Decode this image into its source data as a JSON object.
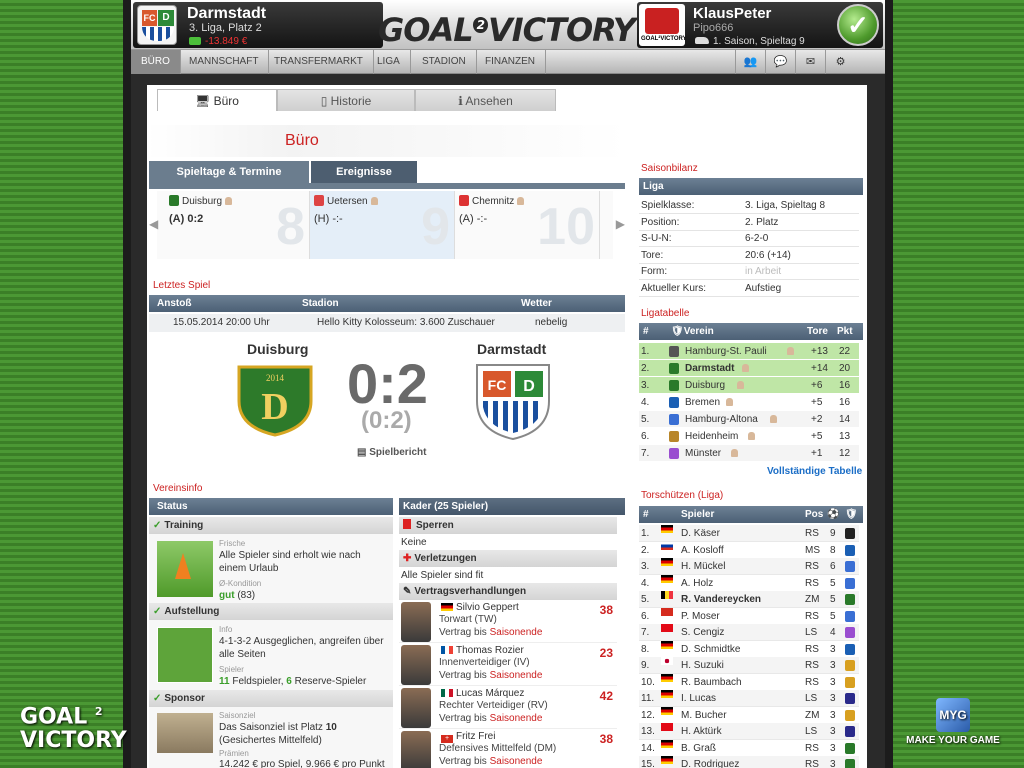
{
  "header": {
    "club": {
      "name": "Darmstadt",
      "league": "3. Liga, Platz 2",
      "money": "-13.849 €",
      "crest_left": "FC",
      "crest_right": "D"
    },
    "logo_text": "GOAL",
    "logo_num": "2",
    "logo_text2": "VICTORY",
    "user": {
      "name": "KlausPeter",
      "sub": "Pipo666",
      "season": "1. Saison, Spieltag 9",
      "badge": "GOAL²VICTORY"
    }
  },
  "nav": {
    "items": [
      "Büro",
      "Mannschaft",
      "Transfermarkt",
      "Liga",
      "Stadion",
      "Finanzen"
    ],
    "icons": [
      "users-icon",
      "chat-icon",
      "mail-icon",
      "settings-icon"
    ]
  },
  "subtabs": [
    "Büro",
    "Historie",
    "Ansehen"
  ],
  "page_title": "Büro",
  "matchdays": {
    "tabs": [
      "Spieltage & Termine",
      "Ereignisse"
    ],
    "items": [
      {
        "num": "8",
        "team": "Duisburg",
        "res": "(A) 0:2"
      },
      {
        "num": "9",
        "team": "Uetersen",
        "res": "(H) -:-"
      },
      {
        "num": "10",
        "team": "Chemnitz",
        "res": "(A) -:-"
      }
    ]
  },
  "last_match": {
    "label": "Letztes Spiel",
    "headers": [
      "Anstoß",
      "Stadion",
      "Wetter"
    ],
    "kickoff": "15.05.2014 20:00 Uhr",
    "stadium": "Hello Kitty Kolosseum: 3.600 Zuschauer",
    "weather": "nebelig",
    "home": "Duisburg",
    "away": "Darmstadt",
    "score": "0:2",
    "halftime": "(0:2)",
    "report": "Spielbericht",
    "home_badge_year": "2014"
  },
  "vereinsinfo": {
    "label": "Vereinsinfo",
    "status_header": "Status",
    "training": {
      "title": "Training",
      "small": "Frische",
      "text": "Alle Spieler sind erholt wie nach einem Urlaub",
      "small2": "Ø-Kondition",
      "kond_value": "gut",
      "kond_num": "(83)"
    },
    "aufstellung": {
      "title": "Aufstellung",
      "small": "Info",
      "text": "4-1-3-2 Ausgeglichen, angreifen über alle Seiten",
      "small2": "Spieler",
      "field": "11",
      "field_label": "Feldspieler,",
      "reserve": "6",
      "reserve_label": "Reserve-Spieler"
    },
    "sponsor": {
      "title": "Sponsor",
      "small": "Saisonziel",
      "text_a": "Das Saisonziel ist Platz",
      "platz": "10",
      "text_b": "(Gesichertes Mittelfeld)",
      "small2": "Prämien",
      "praemie": "14.242 € pro Spiel, 9.966 € pro Punkt"
    }
  },
  "kader": {
    "header": "Kader (25 Spieler)",
    "sperren": "Sperren",
    "sperren_text": "Keine",
    "verletzungen": "Verletzungen",
    "verletzungen_text": "Alle Spieler sind fit",
    "vertrag": "Vertragsverhandlungen",
    "players": [
      {
        "name": "Silvio Geppert",
        "pos": "Torwart (TW)",
        "contract": "Vertrag bis",
        "until": "Saisonende",
        "num": "38",
        "flag": "de"
      },
      {
        "name": "Thomas Rozier",
        "pos": "Innenverteidiger (IV)",
        "contract": "Vertrag bis",
        "until": "Saisonende",
        "num": "23",
        "flag": "fr"
      },
      {
        "name": "Lucas Márquez",
        "pos": "Rechter Verteidiger (RV)",
        "contract": "Vertrag bis",
        "until": "Saisonende",
        "num": "42",
        "flag": "mx"
      },
      {
        "name": "Fritz Frei",
        "pos": "Defensives Mittelfeld (DM)",
        "contract": "Vertrag bis",
        "until": "Saisonende",
        "num": "38",
        "flag": "ch"
      }
    ]
  },
  "saisonbilanz": {
    "label": "Saisonbilanz",
    "header": "Liga",
    "rows": [
      {
        "k": "Spielklasse:",
        "v": "3. Liga, Spieltag 8"
      },
      {
        "k": "Position:",
        "v": "2. Platz"
      },
      {
        "k": "S-U-N:",
        "v": "6-2-0"
      },
      {
        "k": "Tore:",
        "v": "20:6 (+14)"
      },
      {
        "k": "Form:",
        "v": "in Arbeit"
      },
      {
        "k": "Aktueller Kurs:",
        "v": "Aufstieg"
      }
    ]
  },
  "ligatabelle": {
    "label": "Ligatabelle",
    "headers": [
      "#",
      "Verein",
      "Tore",
      "Pkt"
    ],
    "rows": [
      {
        "p": "1.",
        "t": "Hamburg-St. Pauli",
        "g": "+13",
        "pts": "22",
        "hl": true
      },
      {
        "p": "2.",
        "t": "Darmstadt",
        "g": "+14",
        "pts": "20",
        "hl": true,
        "bold": true
      },
      {
        "p": "3.",
        "t": "Duisburg",
        "g": "+6",
        "pts": "16",
        "hl": true
      },
      {
        "p": "4.",
        "t": "Bremen",
        "g": "+5",
        "pts": "16"
      },
      {
        "p": "5.",
        "t": "Hamburg-Altona",
        "g": "+2",
        "pts": "14"
      },
      {
        "p": "6.",
        "t": "Heidenheim",
        "g": "+5",
        "pts": "13"
      },
      {
        "p": "7.",
        "t": "Münster",
        "g": "+1",
        "pts": "12"
      }
    ],
    "link": "Vollständige Tabelle"
  },
  "torschuetzen": {
    "label": "Torschützen (Liga)",
    "headers": [
      "#",
      "Spieler",
      "Pos"
    ],
    "rows": [
      {
        "p": "1.",
        "n": "D. Käser",
        "pos": "RS",
        "g": "9",
        "f": "de"
      },
      {
        "p": "2.",
        "n": "A. Kosloff",
        "pos": "MS",
        "g": "8",
        "f": "ru"
      },
      {
        "p": "3.",
        "n": "H. Mückel",
        "pos": "RS",
        "g": "6",
        "f": "de"
      },
      {
        "p": "4.",
        "n": "A. Holz",
        "pos": "RS",
        "g": "5",
        "f": "de"
      },
      {
        "p": "5.",
        "n": "R. Vandereycken",
        "pos": "ZM",
        "g": "5",
        "f": "be",
        "bold": true
      },
      {
        "p": "6.",
        "n": "P. Moser",
        "pos": "RS",
        "g": "5",
        "f": "ch"
      },
      {
        "p": "7.",
        "n": "S. Cengiz",
        "pos": "LS",
        "g": "4",
        "f": "tr"
      },
      {
        "p": "8.",
        "n": "D. Schmidtke",
        "pos": "RS",
        "g": "3",
        "f": "de"
      },
      {
        "p": "9.",
        "n": "H. Suzuki",
        "pos": "RS",
        "g": "3",
        "f": "jp"
      },
      {
        "p": "10.",
        "n": "R. Baumbach",
        "pos": "RS",
        "g": "3",
        "f": "de"
      },
      {
        "p": "11.",
        "n": "I. Lucas",
        "pos": "LS",
        "g": "3",
        "f": "de"
      },
      {
        "p": "12.",
        "n": "M. Bucher",
        "pos": "ZM",
        "g": "3",
        "f": "de"
      },
      {
        "p": "13.",
        "n": "H. Aktürk",
        "pos": "LS",
        "g": "3",
        "f": "tr"
      },
      {
        "p": "14.",
        "n": "B. Graß",
        "pos": "RS",
        "g": "3",
        "f": "de"
      },
      {
        "p": "15.",
        "n": "D. Rodriguez",
        "pos": "RS",
        "g": "3",
        "f": "de"
      }
    ]
  },
  "corner_logos": {
    "left_a": "GOAL",
    "left_num": "2",
    "left_b": "VICTORY",
    "right_cube": "MYG",
    "right": "MAKE YOUR GAME"
  }
}
